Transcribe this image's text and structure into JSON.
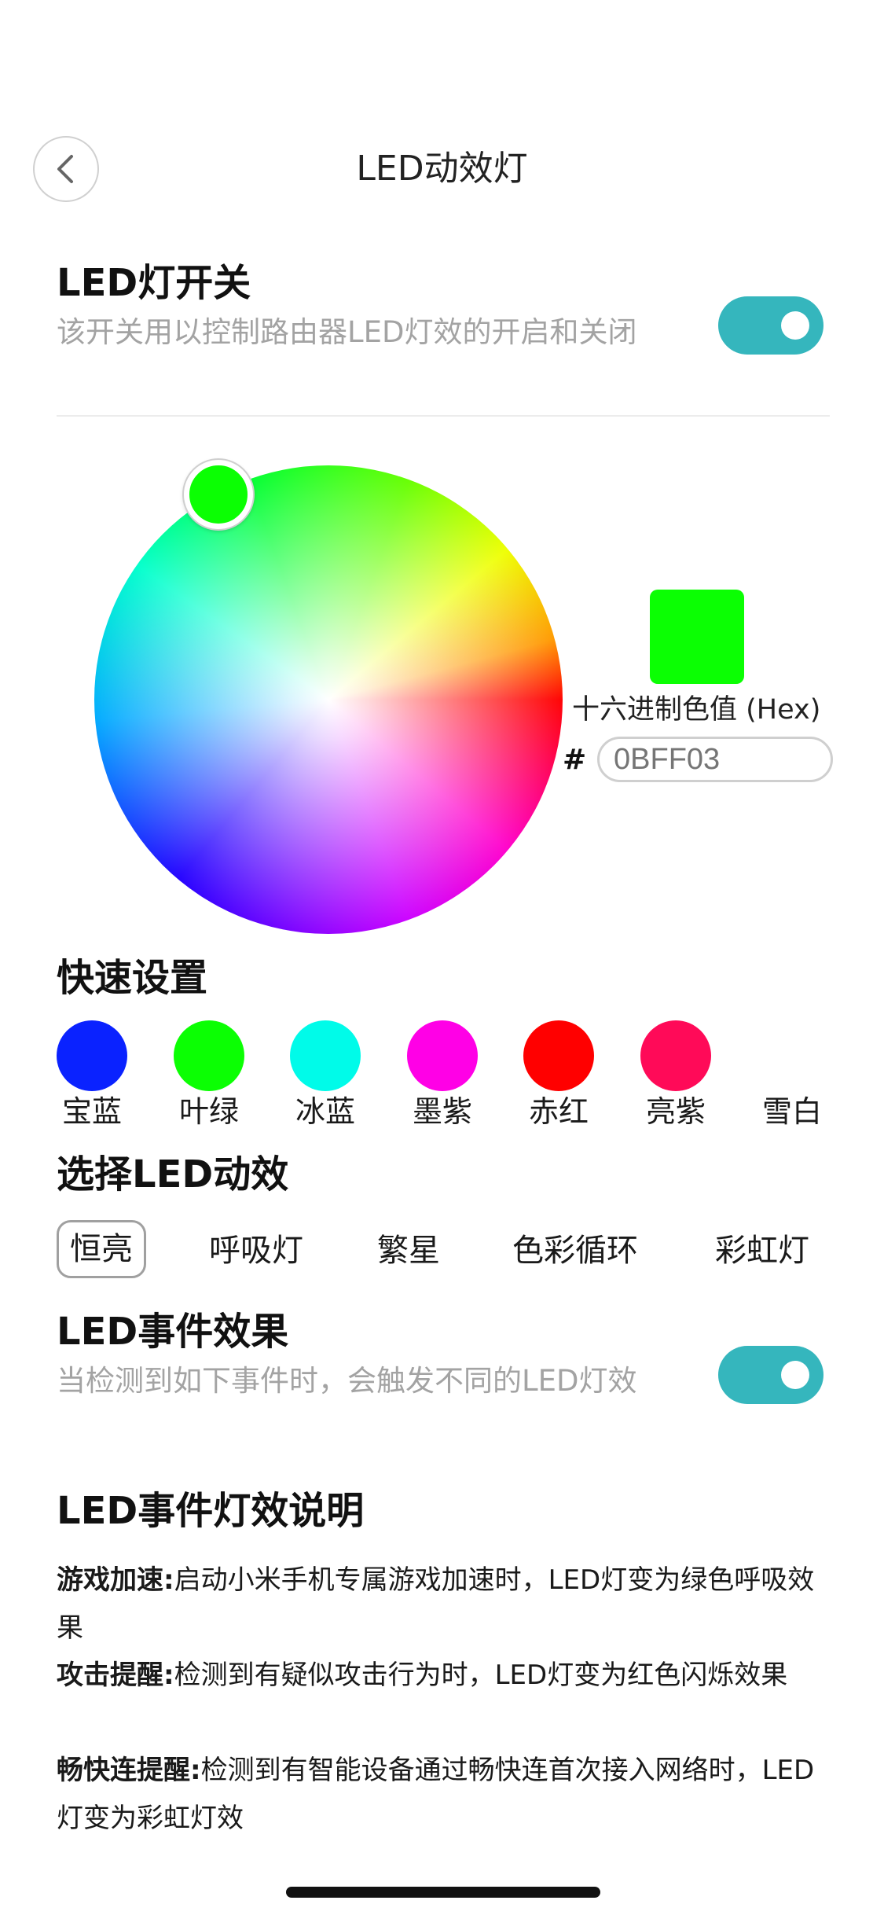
{
  "header": {
    "title": "LED动效灯"
  },
  "led_switch": {
    "title": "LED灯开关",
    "description": "该开关用以控制路由器LED灯效的开启和关闭",
    "enabled": true
  },
  "color_picker": {
    "current_color": "#0BFF03",
    "hex_label": "十六进制色值 (Hex)",
    "hash": "#",
    "hex_value": "0BFF03"
  },
  "quick_settings": {
    "title": "快速设置",
    "colors": [
      {
        "label": "宝蓝",
        "color": "#0a22ff"
      },
      {
        "label": "叶绿",
        "color": "#0bff03"
      },
      {
        "label": "冰蓝",
        "color": "#00fbe9"
      },
      {
        "label": "墨紫",
        "color": "#ff00e6"
      },
      {
        "label": "赤红",
        "color": "#ff0000"
      },
      {
        "label": "亮紫",
        "color": "#ff0a58"
      },
      {
        "label": "雪白",
        "color": "#ffffff"
      }
    ]
  },
  "effects": {
    "title": "选择LED动效",
    "items": [
      "恒亮",
      "呼吸灯",
      "繁星",
      "色彩循环",
      "彩虹灯"
    ],
    "selected": "恒亮"
  },
  "event_effects": {
    "title": "LED事件效果",
    "description": "当检测到如下事件时，会触发不同的LED灯效",
    "enabled": true
  },
  "event_info": {
    "title": "LED事件灯效说明",
    "items": [
      {
        "name": "游戏加速:",
        "text": "启动小米手机专属游戏加速时，LED灯变为绿色呼吸效果"
      },
      {
        "name": "攻击提醒:",
        "text": "检测到有疑似攻击行为时，LED灯变为红色闪烁效果"
      },
      {
        "name": "畅快连提醒:",
        "text": "检测到有智能设备通过畅快连首次接入网络时，LED灯变为彩虹灯效"
      }
    ]
  }
}
